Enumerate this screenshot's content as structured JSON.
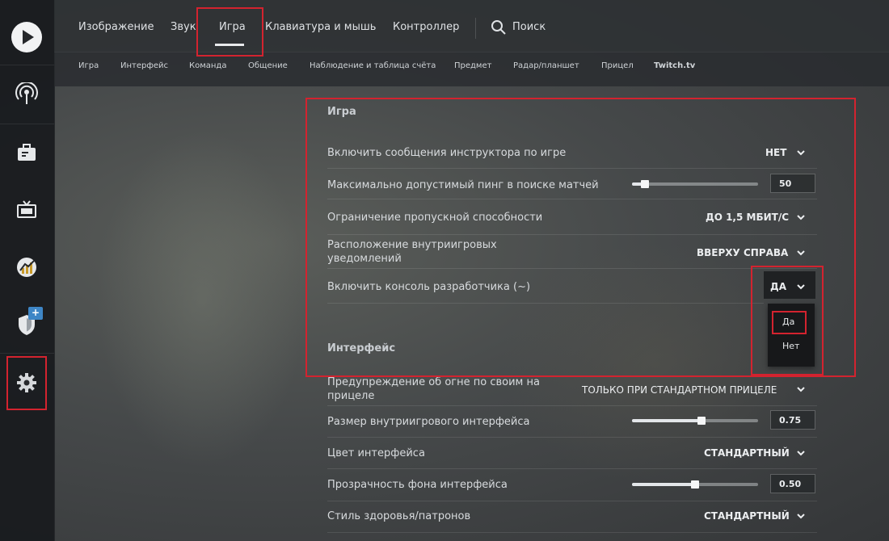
{
  "top_tabs": [
    "Изображение",
    "Звук",
    "Игра",
    "Клавиатура и мышь",
    "Контроллер"
  ],
  "search_label": "Поиск",
  "sub_tabs": [
    "Игра",
    "Интерфейс",
    "Команда",
    "Общение",
    "Наблюдение и таблица счёта",
    "Предмет",
    "Радар/планшет",
    "Прицел",
    "Twitch.tv"
  ],
  "sidebar": {
    "badge": "+"
  },
  "sections": {
    "game": {
      "title": "Игра",
      "rows": [
        {
          "label": "Включить сообщения инструктора по игре",
          "value": "НЕТ"
        },
        {
          "label": "Максимально допустимый пинг в поиске матчей",
          "value": "50",
          "slider_fraction": 0.1
        },
        {
          "label": "Ограничение пропускной способности",
          "value": "ДО 1,5 МБИТ/С"
        },
        {
          "label": "Расположение внутриигровых уведомлений",
          "value": "ВВЕРХУ СПРАВА"
        },
        {
          "label": "Включить консоль разработчика (~)",
          "value": "ДА"
        }
      ],
      "dropdown_options": [
        "Да",
        "Нет"
      ]
    },
    "interface": {
      "title": "Интерфейс",
      "rows": [
        {
          "label": "Предупреждение об огне по своим на прицеле",
          "value": "ТОЛЬКО ПРИ СТАНДАРТНОМ ПРИЦЕЛЕ"
        },
        {
          "label": "Размер внутриигрового интерфейса",
          "value": "0.75",
          "slider_fraction": 0.55
        },
        {
          "label": "Цвет интерфейса",
          "value": "СТАНДАРТНЫЙ"
        },
        {
          "label": "Прозрачность фона интерфейса",
          "value": "0.50",
          "slider_fraction": 0.5
        },
        {
          "label": "Стиль здоровья/патронов",
          "value": "СТАНДАРТНЫЙ"
        }
      ]
    }
  },
  "colors": {
    "highlight": "#d3232f",
    "badge": "#3e86c6"
  }
}
